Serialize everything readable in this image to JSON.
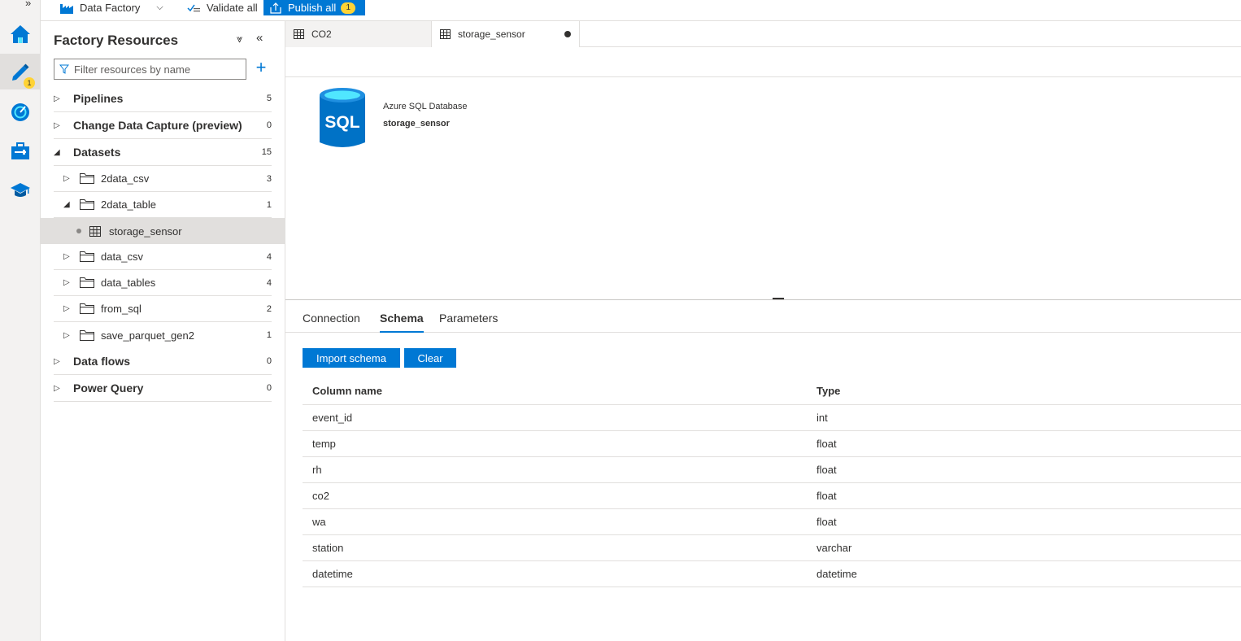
{
  "toolbar": {
    "factory_label": "Data Factory",
    "validate_label": "Validate all",
    "publish_label": "Publish all",
    "publish_count": "1"
  },
  "rail": {
    "author_badge": "1",
    "expand_glyph": "»"
  },
  "resources": {
    "title": "Factory Resources",
    "filter_placeholder": "Filter resources by name",
    "categories": [
      {
        "label": "Pipelines",
        "count": "5"
      },
      {
        "label": "Change Data Capture (preview)",
        "count": "0"
      },
      {
        "label": "Datasets",
        "count": "15"
      },
      {
        "label": "Data flows",
        "count": "0"
      },
      {
        "label": "Power Query",
        "count": "0"
      }
    ],
    "folders": [
      {
        "label": "2data_csv",
        "count": "3"
      },
      {
        "label": "2data_table",
        "count": "1"
      },
      {
        "label": "data_csv",
        "count": "4"
      },
      {
        "label": "data_tables",
        "count": "4"
      },
      {
        "label": "from_sql",
        "count": "2"
      },
      {
        "label": "save_parquet_gen2",
        "count": "1"
      }
    ],
    "selected_dataset": "storage_sensor"
  },
  "tabs": [
    {
      "label": "CO2"
    },
    {
      "label": "storage_sensor"
    }
  ],
  "dataset": {
    "type": "Azure SQL Database",
    "name": "storage_sensor",
    "icon_text": "SQL"
  },
  "bottom_tabs": [
    "Connection",
    "Schema",
    "Parameters"
  ],
  "actions": {
    "import_label": "Import schema",
    "clear_label": "Clear"
  },
  "schema": {
    "headers": [
      "Column name",
      "Type"
    ],
    "rows": [
      [
        "event_id",
        "int"
      ],
      [
        "temp",
        "float"
      ],
      [
        "rh",
        "float"
      ],
      [
        "co2",
        "float"
      ],
      [
        "wa",
        "float"
      ],
      [
        "station",
        "varchar"
      ],
      [
        "datetime",
        "datetime"
      ]
    ]
  },
  "colors": {
    "accent": "#0078d4",
    "badge": "#ffd335"
  }
}
